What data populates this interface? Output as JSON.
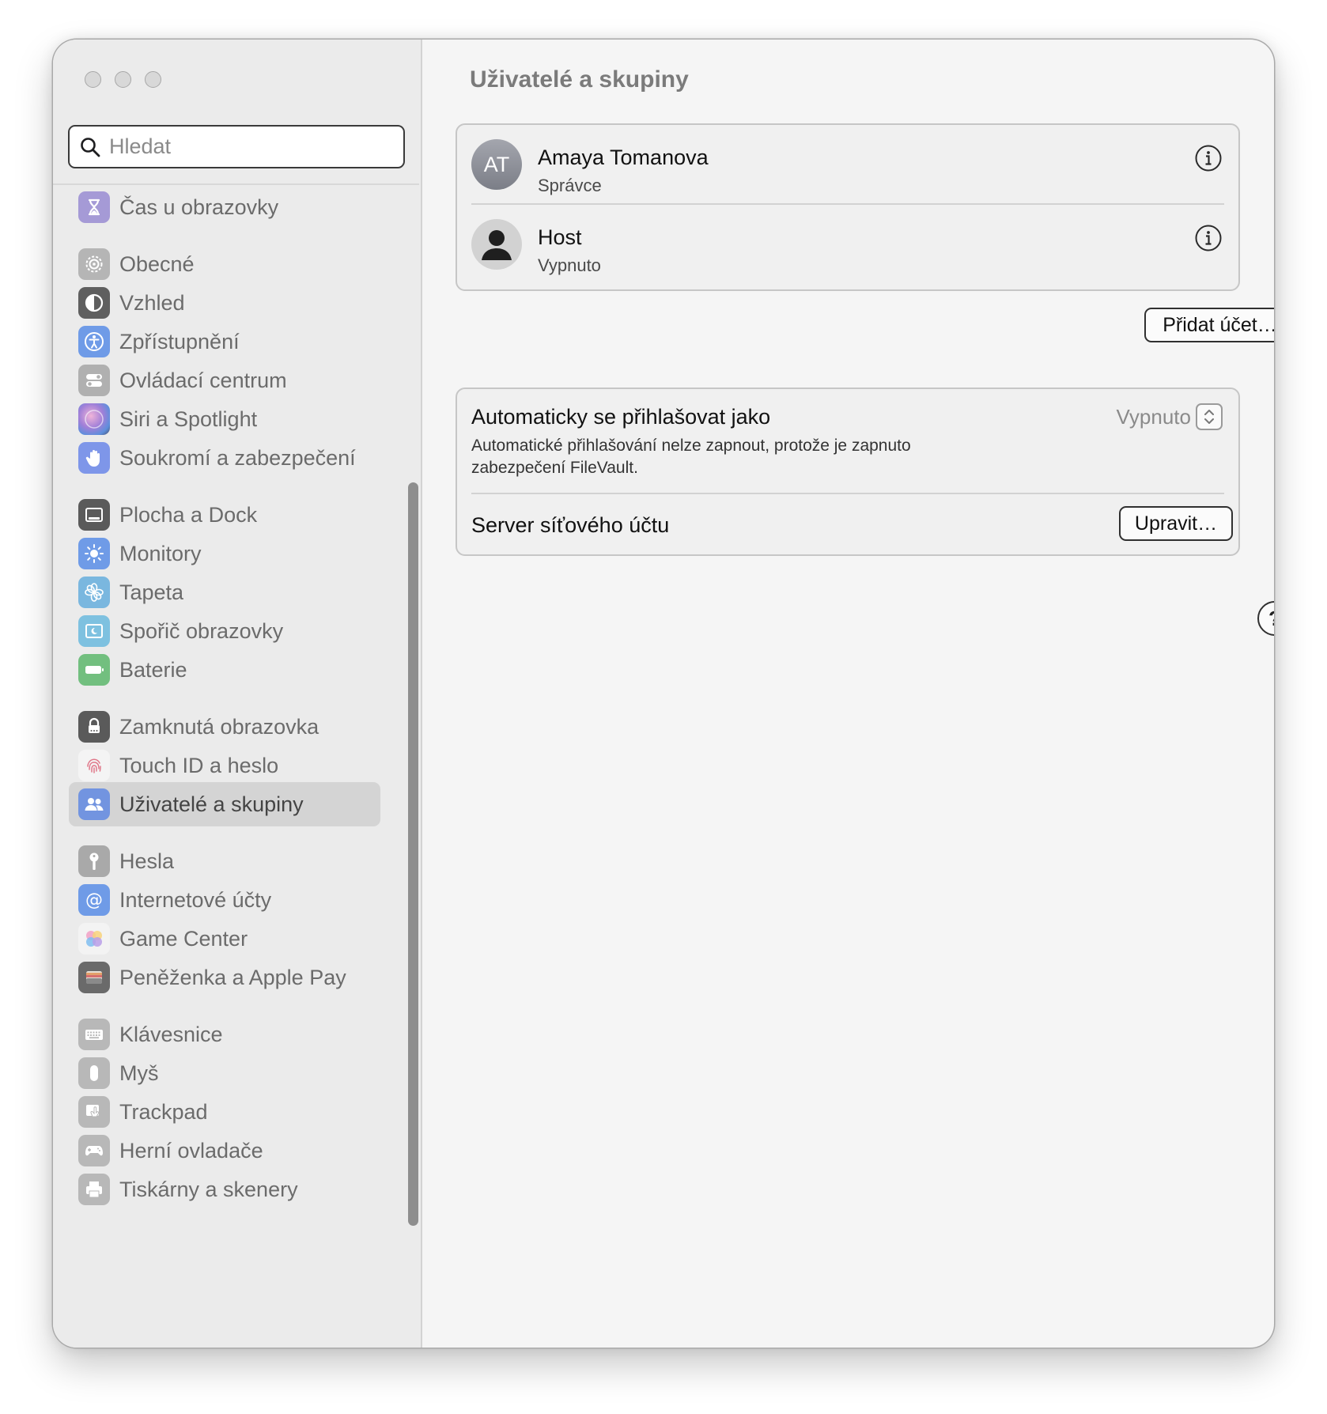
{
  "window": {
    "traffic_lights": [
      "close",
      "minimize",
      "zoom"
    ]
  },
  "search": {
    "placeholder": "Hledat",
    "value": ""
  },
  "sidebar": {
    "items": [
      {
        "label": "Čas u obrazovky",
        "icon": "hourglass-icon",
        "color": "#a59ad6",
        "selected": false
      },
      {
        "label": "Obecné",
        "icon": "gear-icon",
        "color": "#b5b5b5",
        "selected": false
      },
      {
        "label": "Vzhled",
        "icon": "appearance-icon",
        "color": "#5f5f5f",
        "selected": false
      },
      {
        "label": "Zpřístupnění",
        "icon": "accessibility-icon",
        "color": "#6f9be7",
        "selected": false
      },
      {
        "label": "Ovládací centrum",
        "icon": "control-center-icon",
        "color": "#b0b0b0",
        "selected": false
      },
      {
        "label": "Siri a Spotlight",
        "icon": "siri-icon",
        "color": "#c58ec9",
        "selected": false
      },
      {
        "label": "Soukromí a zabezpečení",
        "icon": "hand-icon",
        "color": "#7e96e9",
        "selected": false
      },
      {
        "label": "Plocha a Dock",
        "icon": "dock-icon",
        "color": "#5a5a5a",
        "selected": false
      },
      {
        "label": "Monitory",
        "icon": "brightness-icon",
        "color": "#6f9be7",
        "selected": false
      },
      {
        "label": "Tapeta",
        "icon": "flower-icon",
        "color": "#7ab7df",
        "selected": false
      },
      {
        "label": "Spořič obrazovky",
        "icon": "screensaver-icon",
        "color": "#7ec1e0",
        "selected": false
      },
      {
        "label": "Baterie",
        "icon": "battery-icon",
        "color": "#72bf7f",
        "selected": false
      },
      {
        "label": "Zamknutá obrazovka",
        "icon": "lock-icon",
        "color": "#5a5a5a",
        "selected": false
      },
      {
        "label": "Touch ID a heslo",
        "icon": "fingerprint-icon",
        "color": "#f4f4f4",
        "selected": false
      },
      {
        "label": "Uživatelé a skupiny",
        "icon": "users-icon",
        "color": "#7294e0",
        "selected": true
      },
      {
        "label": "Hesla",
        "icon": "key-icon",
        "color": "#a9a9a9",
        "selected": false
      },
      {
        "label": "Internetové účty",
        "icon": "at-icon",
        "color": "#6f9be7",
        "selected": false
      },
      {
        "label": "Game Center",
        "icon": "game-center-icon",
        "color": "#f3f3f3",
        "selected": false
      },
      {
        "label": "Peněženka a Apple Pay",
        "icon": "wallet-icon",
        "color": "#6a6a6a",
        "selected": false
      },
      {
        "label": "Klávesnice",
        "icon": "keyboard-icon",
        "color": "#b8b8b8",
        "selected": false
      },
      {
        "label": "Myš",
        "icon": "mouse-icon",
        "color": "#b8b8b8",
        "selected": false
      },
      {
        "label": "Trackpad",
        "icon": "trackpad-icon",
        "color": "#b8b8b8",
        "selected": false
      },
      {
        "label": "Herní ovladače",
        "icon": "gamepad-icon",
        "color": "#b8b8b8",
        "selected": false
      },
      {
        "label": "Tiskárny a skenery",
        "icon": "printer-icon",
        "color": "#b8b8b8",
        "selected": false
      }
    ]
  },
  "main": {
    "title": "Uživatelé a skupiny",
    "users": [
      {
        "initials": "AT",
        "name": "Amaya Tomanova",
        "role": "Správce",
        "avatar": "initials"
      },
      {
        "initials": "",
        "name": "Host",
        "role": "Vypnuto",
        "avatar": "person-icon"
      }
    ],
    "add_account_label": "Přidat účet…",
    "autologin": {
      "title": "Automaticky se přihlašovat jako",
      "description": "Automatické přihlašování nelze zapnout, protože je zapnuto zabezpečení FileVault.",
      "value": "Vypnuto"
    },
    "network_server": {
      "label": "Server síťového účtu",
      "button_label": "Upravit…"
    },
    "help_label": "?"
  }
}
